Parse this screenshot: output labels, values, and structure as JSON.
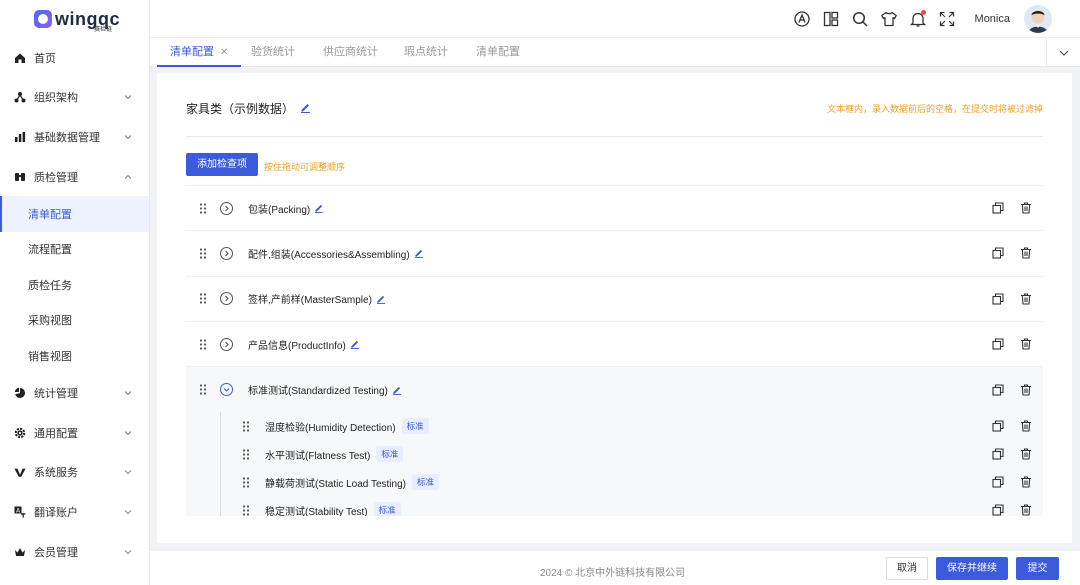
{
  "brand": {
    "name": "wingqc",
    "sub": "赛检链"
  },
  "sidebar": {
    "items": [
      {
        "label": "首页",
        "icon": "home-icon"
      },
      {
        "label": "组织架构",
        "icon": "org-icon"
      },
      {
        "label": "基础数据管理",
        "icon": "chart-icon"
      },
      {
        "label": "质检管理",
        "icon": "qc-icon"
      },
      {
        "label": "统计管理",
        "icon": "pie-icon"
      },
      {
        "label": "通用配置",
        "icon": "gear-icon"
      },
      {
        "label": "系统服务",
        "icon": "service-icon"
      },
      {
        "label": "翻译账户",
        "icon": "translate-icon"
      },
      {
        "label": "会员管理",
        "icon": "crown-icon"
      }
    ],
    "sub_items": [
      "清单配置",
      "流程配置",
      "质检任务",
      "采购视图",
      "销售视图"
    ]
  },
  "header": {
    "username": "Monica"
  },
  "tabs": [
    "清单配置",
    "验货统计",
    "供应商统计",
    "瑕点统计",
    "清单配置"
  ],
  "card": {
    "title": "家具类（示例数据）",
    "tip": "文本框内，录入数据前后的空格，在提交时将被过滤掉",
    "add_button": "添加检查项",
    "drag_tip": "按住拖动可调整顺序"
  },
  "rows": [
    "包装(Packing)",
    "配件,组装(Accessories&Assembling)",
    "签样,产前样(MasterSample)",
    "产品信息(ProductInfo)",
    "标准测试(Standardized Testing)"
  ],
  "sub_rows": [
    {
      "label": "湿度检验(Humidity Detection)",
      "tag": "标准"
    },
    {
      "label": "水平测试(Flatness Test)",
      "tag": "标准"
    },
    {
      "label": "静载荷测试(Static Load Testing)",
      "tag": "标准"
    },
    {
      "label": "稳定测试(Stability Test)",
      "tag": "标准"
    }
  ],
  "footer": {
    "copyright": "2024 © 北京中外链科技有限公司",
    "cancel": "取消",
    "save_continue": "保存并继续",
    "submit": "提交"
  },
  "colors": {
    "primary": "#3b5bdb",
    "warning": "#f0a020"
  }
}
